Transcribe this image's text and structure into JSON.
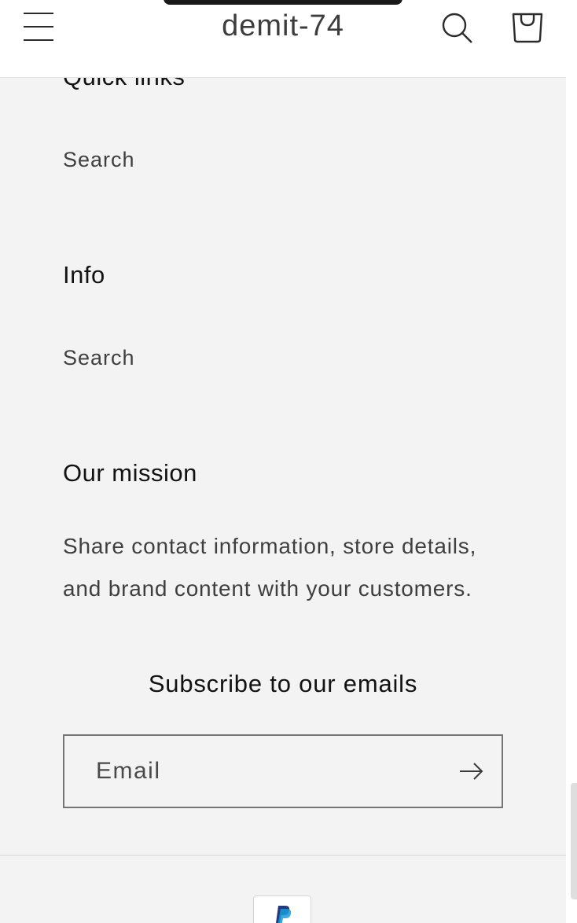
{
  "header": {
    "store_name": "demit-74",
    "menu_icon": "hamburger-menu-icon",
    "search_icon": "search-icon",
    "cart_icon": "cart-icon"
  },
  "footer": {
    "quick_links": {
      "heading": "Quick links",
      "items": [
        "Search"
      ]
    },
    "info": {
      "heading": "Info",
      "items": [
        "Search"
      ]
    },
    "mission": {
      "heading": "Our mission",
      "text_line1": "Share contact information, store details,",
      "text_line2": "and brand content with your customers."
    },
    "newsletter": {
      "title": "Subscribe to our emails",
      "email_placeholder": "Email",
      "submit_icon": "arrow-right-icon"
    },
    "payment": {
      "icons": [
        "paypal-icon"
      ]
    }
  },
  "colors": {
    "background": "#f3f3f3",
    "header_background": "#ffffff",
    "text_primary": "#121212",
    "text_secondary": "#3f3f3f",
    "border": "#757575",
    "paypal_dark": "#253b80",
    "paypal_light": "#179bd7"
  }
}
